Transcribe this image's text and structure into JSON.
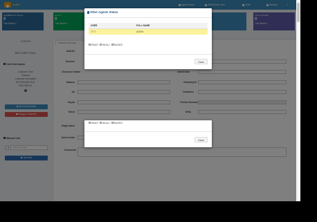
{
  "nav": {
    "logo_text": "Icotel",
    "logo_sub": "",
    "links": [
      {
        "label": "Agent Name"
      },
      {
        "label": "WebPhone View"
      },
      {
        "label": "CRM"
      },
      {
        "label": "Session"
      },
      {
        "label": "1 -"
      }
    ]
  },
  "stats": [
    {
      "label": "NUMBER OF CALLS",
      "value": "0",
      "footer": "This Month 0",
      "color": "#2c6a98"
    },
    {
      "label": "S.E. IN",
      "value": "0",
      "footer": "This Month 0",
      "color": "#00a65a"
    },
    {
      "label": "",
      "value": "0",
      "footer": "",
      "color": "#3c8dbc"
    },
    {
      "label": "TOTAL SALES",
      "value": "0",
      "footer": "This Month 0",
      "color": "#605ca8"
    }
  ],
  "left_panel": {
    "status_label": "STATUS",
    "status_value": "NO LIVE CALL",
    "call_info_title": "Call Information",
    "call_info_lines": [
      "Customer Time:",
      "Channel:",
      "Customer Information",
      "RECORDING FILE:",
      "RECORD ID:"
    ],
    "btn_dial_next": "Dial Next Number",
    "btn_hangup": "Hangup Customer",
    "manual_call_title": "Manual Call",
    "phone_placeholder": "Phone Number",
    "btn_dial_now": "Dial Now"
  },
  "form": {
    "tab_label": "Customer Informati...",
    "left_labels": [
      "Aktivite",
      "Gecmisi",
      "Gorusme Notlari",
      "Statusu",
      "Ad",
      "Soyad",
      "Sirket",
      "Bagli Adres",
      "Adres Kodu",
      "Comments"
    ],
    "right_labels": [
      "Statu",
      "Dahili Date",
      "Hassasiyeti",
      "Hesabiniz",
      "Postakodu",
      "Telefon Numarasi",
      "MHA"
    ]
  },
  "modal": {
    "title": "Other Agents Status",
    "columns": [
      "USER",
      "FULL NAME"
    ],
    "rows": [
      {
        "user": "7777",
        "full_name": "ADMIN"
      }
    ],
    "legend": [
      {
        "label": "READY",
        "color": "#add8e6"
      },
      {
        "label": "INCALL",
        "color": "#d8bfd8"
      },
      {
        "label": "PAUSED",
        "color": "#f0e68c"
      }
    ],
    "close_label": "Close"
  },
  "modal2": {
    "legend": [
      {
        "label": "READY",
        "color": "#add8e6"
      },
      {
        "label": "INCALL",
        "color": "#d8bfd8"
      },
      {
        "label": "PAUSED",
        "color": "#f0e68c"
      }
    ],
    "close_label": "Close"
  }
}
